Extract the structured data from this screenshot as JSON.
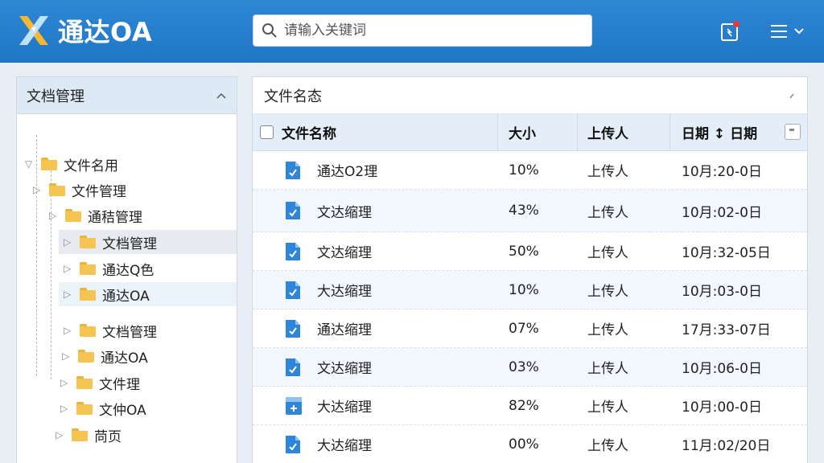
{
  "app": {
    "brand": "通达OA"
  },
  "header": {
    "search_placeholder": "请输入关键词"
  },
  "sidebar": {
    "title": "文档管理",
    "items": [
      {
        "label": "文件名用"
      },
      {
        "label": "文件管理"
      },
      {
        "label": "通秸管理"
      },
      {
        "label": "文档管理"
      },
      {
        "label": "通达Q色"
      },
      {
        "label": "通达OA"
      },
      {
        "label": "文档管理"
      },
      {
        "label": "通达OA"
      },
      {
        "label": "文件理"
      },
      {
        "label": "文仲OA"
      },
      {
        "label": "苘页"
      }
    ]
  },
  "main": {
    "title": "文件名态",
    "columns": {
      "name": "文件名称",
      "size": "大小",
      "uploader": "上传人",
      "date": "日期 ↕ 日期"
    },
    "rows": [
      {
        "name": "通达O2理",
        "size": "10%",
        "uploader": "上传人",
        "date": "10月:20-0日"
      },
      {
        "name": "文达缩理",
        "size": "43%",
        "uploader": "上传人",
        "date": "10月:02-0日"
      },
      {
        "name": "文达缩理",
        "size": "50%",
        "uploader": "上传人",
        "date": "10月:32-05日"
      },
      {
        "name": "大达缩理",
        "size": "10%",
        "uploader": "上传人",
        "date": "10月:03-0日"
      },
      {
        "name": "通达缩理",
        "size": "07%",
        "uploader": "上传人",
        "date": "17月:33-07日"
      },
      {
        "name": "文达缩理",
        "size": "03%",
        "uploader": "上传人",
        "date": "10月:06-0日"
      },
      {
        "name": "大达缩理",
        "size": "82%",
        "uploader": "上传人",
        "date": "10月:00-0日"
      },
      {
        "name": "大达缩理",
        "size": "00%",
        "uploader": "上传人",
        "date": "11月:02/20日"
      }
    ]
  }
}
